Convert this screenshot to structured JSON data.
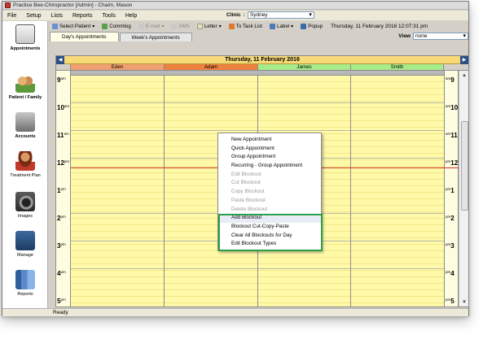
{
  "window": {
    "title": "Practice Bee-Chiropractor [Admin] - Chaim, Mason"
  },
  "menubar": {
    "items": [
      "File",
      "Setup",
      "Lists",
      "Reports",
      "Tools",
      "Help"
    ],
    "clinic_label": "Clinic",
    "clinic_value": "Sydney"
  },
  "toolbar": {
    "select_patient": "Select Patient",
    "commlog": "Commlog",
    "email": "E-mail",
    "sms": "SMS",
    "letter": "Letter",
    "to_task_list": "To Task List",
    "label": "Label",
    "popup": "Popup",
    "datetime": "Thursday, 11 February 2016 12:07:31 pm"
  },
  "sidebar": {
    "items": [
      {
        "label": "Appointments",
        "icon": "clipboard-icon"
      },
      {
        "label": "Patient / Family",
        "icon": "family-icon"
      },
      {
        "label": "Accounts",
        "icon": "cash-register-icon"
      },
      {
        "label": "Treatment Plan",
        "icon": "doctor-icon"
      },
      {
        "label": "Images",
        "icon": "camera-icon"
      },
      {
        "label": "Manage",
        "icon": "manage-icon"
      },
      {
        "label": "Reports",
        "icon": "reports-icon"
      }
    ]
  },
  "tabs": {
    "days": "Day's Appointments",
    "weeks": "Week's Appointments",
    "view_label": "View",
    "view_value": "none"
  },
  "schedule": {
    "date": "Thursday, 11 February 2016",
    "providers": [
      {
        "name": "Eden",
        "color": "#f0a070"
      },
      {
        "name": "Adam",
        "color": "#ee8040"
      },
      {
        "name": "James",
        "color": "#a8ec8a"
      },
      {
        "name": "Smith",
        "color": "#a8ec8a"
      }
    ],
    "hours": [
      {
        "h": "9",
        "ap": "am"
      },
      {
        "h": "10",
        "ap": "am"
      },
      {
        "h": "11",
        "ap": "am"
      },
      {
        "h": "12",
        "ap": "pm"
      },
      {
        "h": "1",
        "ap": "pm"
      },
      {
        "h": "2",
        "ap": "pm"
      },
      {
        "h": "3",
        "ap": "pm"
      },
      {
        "h": "4",
        "ap": "pm"
      },
      {
        "h": "5",
        "ap": "pm"
      }
    ]
  },
  "context_menu": {
    "items": [
      {
        "label": "New Appointment",
        "enabled": true
      },
      {
        "label": "Quick Appointment",
        "enabled": true
      },
      {
        "label": "Group Appointment",
        "enabled": true
      },
      {
        "label": "Recurring - Group Appointment",
        "enabled": true
      },
      {
        "label": "Edit Blockout",
        "enabled": false
      },
      {
        "label": "Cut Blockout",
        "enabled": false
      },
      {
        "label": "Copy Blockout",
        "enabled": false
      },
      {
        "label": "Paste Blockout",
        "enabled": false
      },
      {
        "label": "Delete Blockout",
        "enabled": false
      },
      {
        "label": "Add Blockout",
        "enabled": true
      },
      {
        "label": "Blockout Cut-Copy-Paste",
        "enabled": true
      },
      {
        "label": "Clear All Blockouts for Day",
        "enabled": true
      },
      {
        "label": "Edit Blockout Types",
        "enabled": true
      }
    ]
  },
  "status": {
    "text": "Ready"
  }
}
